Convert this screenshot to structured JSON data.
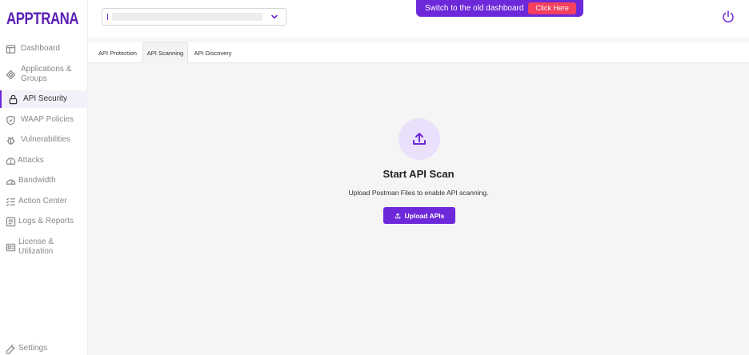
{
  "brand": {
    "logo_text": "APPTRANA",
    "accent_color": "#6d28d9"
  },
  "header": {
    "app_select": {
      "value": "",
      "icon": "chevron-down-icon"
    },
    "banner": {
      "text": "Switch to the old dashboard",
      "button_label": "Click Here",
      "button_color": "#f43f5e"
    },
    "power_icon": "power-icon"
  },
  "sidebar": {
    "items": [
      {
        "label": "Dashboard",
        "icon": "dashboard-icon",
        "active": false
      },
      {
        "label": "Applications & Groups",
        "icon": "applications-icon",
        "active": false
      },
      {
        "label": "API Security",
        "icon": "lock-icon",
        "active": true
      },
      {
        "label": "WAAP Policies",
        "icon": "shield-icon",
        "active": false
      },
      {
        "label": "Vulnerabilities",
        "icon": "bug-icon",
        "active": false
      },
      {
        "label": "Attacks",
        "icon": "alert-icon",
        "active": false
      },
      {
        "label": "Bandwidth",
        "icon": "gauge-icon",
        "active": false
      },
      {
        "label": "Action Center",
        "icon": "checklist-icon",
        "active": false
      },
      {
        "label": "Logs & Reports",
        "icon": "logs-icon",
        "active": false
      },
      {
        "label": "License & Utilization",
        "icon": "license-icon",
        "active": false
      }
    ],
    "settings": {
      "label": "Settings",
      "icon": "wrench-icon"
    }
  },
  "tabs": [
    {
      "label": "API Protection",
      "active": false
    },
    {
      "label": "API Scanning",
      "active": true
    },
    {
      "label": "API Discovery",
      "active": false
    }
  ],
  "main": {
    "icon": "upload-icon",
    "title": "Start API Scan",
    "subtitle": "Upload Postman Files to enable API scanning.",
    "upload_button_label": "Upload APIs"
  }
}
